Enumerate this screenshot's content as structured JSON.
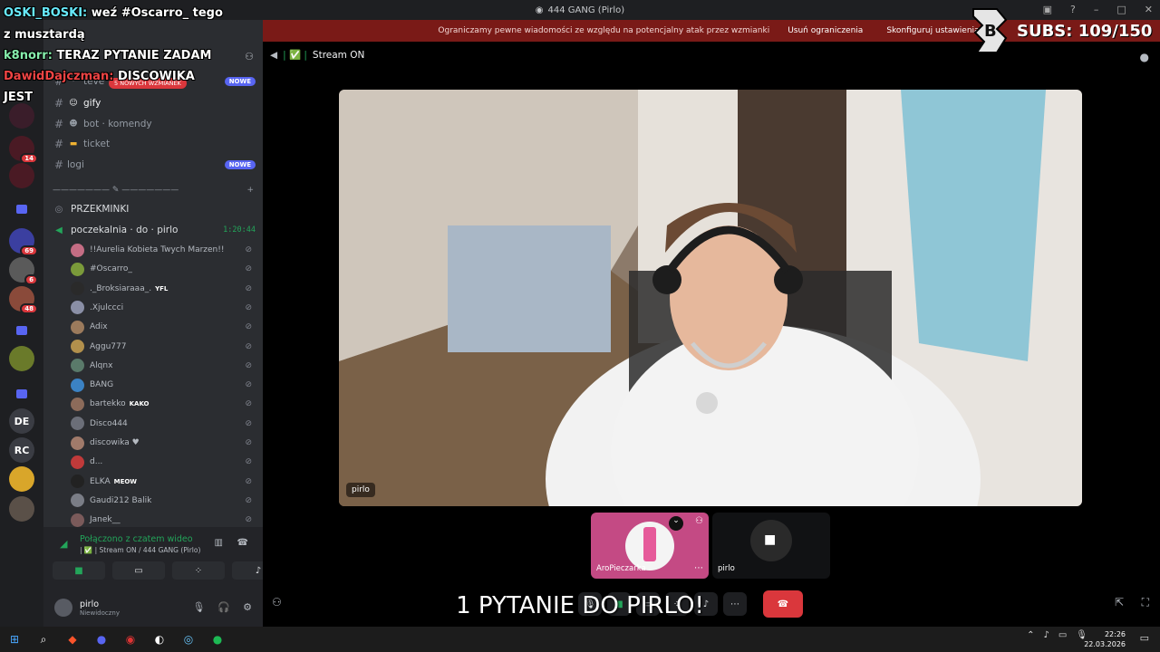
{
  "window": {
    "title": "444 GANG (Pirlo)"
  },
  "notice": {
    "text": "Ograniczamy pewne wiadomości ze względu na potencjalny atak przez wzmianki",
    "btn_remove": "Usuń ograniczenia",
    "btn_configure": "Skonfiguruj ustawienia"
  },
  "rail": {
    "items": [
      {
        "label": "JEST"
      },
      {
        "badge": "14"
      },
      {
        "badge": "69"
      },
      {
        "badge": "6"
      },
      {
        "badge": "48"
      },
      {
        "label": "DE"
      },
      {
        "label": "RC"
      }
    ]
  },
  "sidebar": {
    "mention_pill": "5 NOWYCH WZMIANEK",
    "channels": [
      {
        "name": "teve",
        "new": "NOWE"
      },
      {
        "name": "gify",
        "active": true
      },
      {
        "name": "bot · komendy"
      },
      {
        "name": "ticket"
      },
      {
        "name": "logi",
        "new": "NOWE"
      }
    ],
    "divider": "——————— ✎ ———————",
    "voice_channels": [
      {
        "name": "PRZEKMINKI"
      },
      {
        "name": "poczekalnia · do · pirlo",
        "timer": "1:20:44"
      }
    ],
    "voice_users": [
      {
        "name": "!!Aurelia Kobieta Twych Marzen!!",
        "color": "#c46d84"
      },
      {
        "name": "#Oscarro_",
        "color": "#7a9a3a"
      },
      {
        "name": "._Broksiaraaa_.",
        "tag": "YFL",
        "color": "#2a2a2a"
      },
      {
        "name": ".Xjulccci",
        "color": "#8a8fa6"
      },
      {
        "name": "Adix",
        "color": "#9b7a5c"
      },
      {
        "name": "Aggu777",
        "color": "#b2904c"
      },
      {
        "name": "Alqnx",
        "color": "#5a7a6a"
      },
      {
        "name": "BANG",
        "color": "#3b82c4"
      },
      {
        "name": "bartekko",
        "tag": "KAKO",
        "color": "#8c6b5a"
      },
      {
        "name": "Disco444",
        "color": "#6b6e78"
      },
      {
        "name": "discowika ♥",
        "color": "#a07a6a"
      },
      {
        "name": "d...",
        "color": "#c03a3a"
      },
      {
        "name": "ELKA",
        "tag": "MEOW",
        "color": "#222"
      },
      {
        "name": "Gaudi212 Balik",
        "color": "#7a7d86"
      },
      {
        "name": "Janek__",
        "color": "#7a5a5a"
      }
    ],
    "voice_panel": {
      "title": "Połączono z czatem wideo",
      "subtitle": "| ✅ | Stream ON / 444 GANG (Pirlo)"
    },
    "user": {
      "name": "pirlo",
      "status": "Niewidoczny"
    }
  },
  "stage": {
    "channel": "Stream ON",
    "main_label": "pirlo",
    "tiles": [
      {
        "label": "AroPieczarka"
      },
      {
        "label": "pirlo"
      }
    ]
  },
  "overlay": {
    "chat": [
      {
        "user": "OSKI_BOSKI:",
        "text": "weź #Oscarro_ tego"
      },
      {
        "user": "",
        "text": "z musztardą"
      },
      {
        "user": "k8norr:",
        "text": "TERAZ PYTANIE ZADAM"
      },
      {
        "user": "DawidDajczman:",
        "text": "DISCOWIKA"
      },
      {
        "user": "",
        "text": "JEST"
      }
    ],
    "subs": "SUBS: 109/150",
    "caption": "1 PYTANIE DO PIRLO!"
  },
  "taskbar": {
    "time": "22:26",
    "date": "22.03.2026"
  },
  "colors": {
    "accent": "#5865f2",
    "danger": "#da373c",
    "online": "#23a55a"
  }
}
